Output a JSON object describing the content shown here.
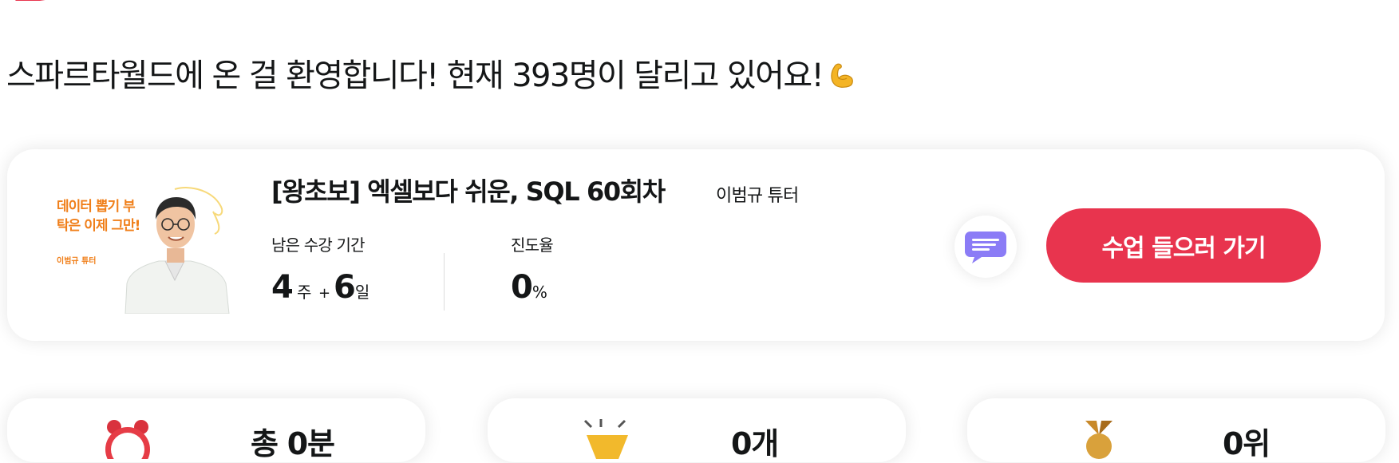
{
  "welcome": {
    "text": "스파르타월드에 온 걸 환영합니다! 현재 393명이 달리고 있어요!"
  },
  "course": {
    "thumbnail": {
      "headline": "데이터 뽑기 부탁은 이제 그만!",
      "tutor": "이범규 튜터"
    },
    "title": "[왕초보] 엑셀보다 쉬운, SQL 60회차",
    "tutor": "이범규 튜터",
    "remaining_label": "남은 수강 기간",
    "remaining_weeks": "4",
    "weeks_unit": "주",
    "plus_sign": "+",
    "remaining_days": "6",
    "days_unit": "일",
    "progress_label": "진도율",
    "progress_value": "0",
    "progress_unit": "%",
    "cta_label": "수업 들으러 가기"
  },
  "stats": [
    {
      "icon": "alarm-clock-icon",
      "value": "총 0분"
    },
    {
      "icon": "party-popper-icon",
      "value": "0개"
    },
    {
      "icon": "medal-icon",
      "value": "0위"
    }
  ],
  "colors": {
    "accent": "#e8344e",
    "thumbnail_text": "#f07f1a",
    "chat_icon": "#8b7cf6"
  }
}
